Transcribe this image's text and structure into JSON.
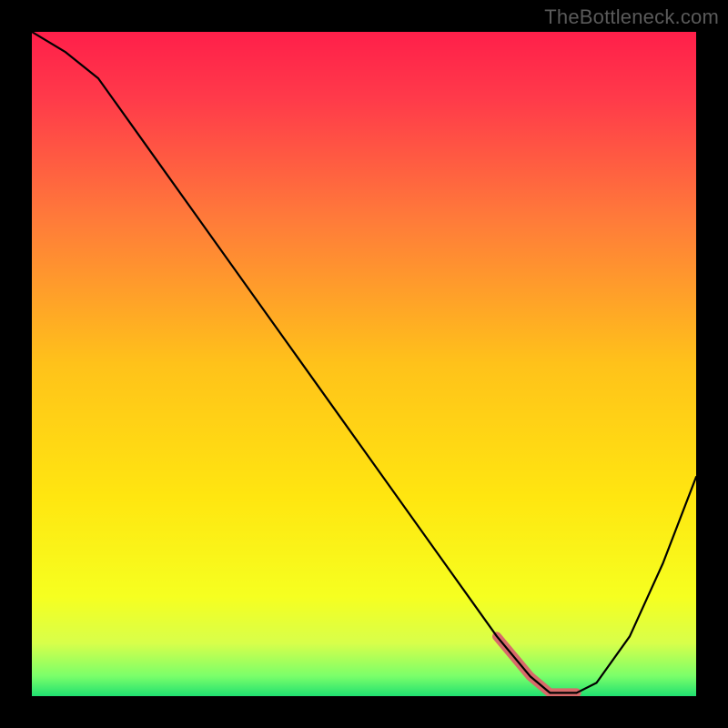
{
  "watermark": "TheBottleneck.com",
  "chart_data": {
    "type": "line",
    "title": "",
    "xlabel": "",
    "ylabel": "",
    "xlim": [
      0,
      100
    ],
    "ylim": [
      0,
      100
    ],
    "grid": false,
    "legend": false,
    "x": [
      0,
      5,
      10,
      15,
      20,
      25,
      30,
      35,
      40,
      45,
      50,
      55,
      60,
      65,
      70,
      75,
      78,
      82,
      85,
      90,
      95,
      100
    ],
    "values": [
      100,
      97,
      93,
      86,
      79,
      72,
      65,
      58,
      51,
      44,
      37,
      30,
      23,
      16,
      9,
      3,
      0.5,
      0.5,
      2,
      9,
      20,
      33
    ],
    "highlight_range_x": [
      70,
      84
    ]
  },
  "gradient_stops": [
    {
      "offset": 0.0,
      "color": "#ff1f4a"
    },
    {
      "offset": 0.1,
      "color": "#ff3a4a"
    },
    {
      "offset": 0.28,
      "color": "#ff7a3a"
    },
    {
      "offset": 0.5,
      "color": "#ffc21a"
    },
    {
      "offset": 0.7,
      "color": "#ffe610"
    },
    {
      "offset": 0.85,
      "color": "#f6ff20"
    },
    {
      "offset": 0.92,
      "color": "#d8ff4a"
    },
    {
      "offset": 0.97,
      "color": "#7aff6a"
    },
    {
      "offset": 1.0,
      "color": "#20e070"
    }
  ],
  "colors": {
    "background": "#000000",
    "curve": "#000000",
    "highlight": "#d86a6a",
    "watermark": "#5a5a5a"
  }
}
